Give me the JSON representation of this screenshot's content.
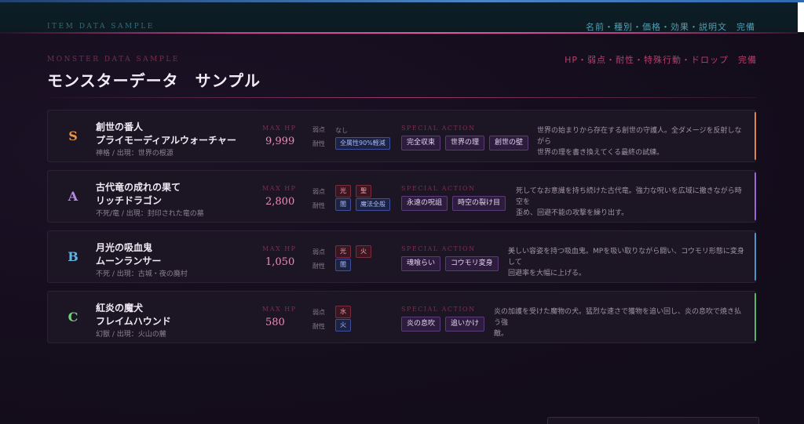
{
  "top_section": {
    "eyebrow": "ITEM DATA SAMPLE",
    "meta": "名前・種別・価格・効果・説明文　完備"
  },
  "monster_section": {
    "eyebrow": "MONSTER DATA SAMPLE",
    "meta": "HP・弱点・耐性・特殊行動・ドロップ　完備",
    "title": "モンスターデータ　サンプル"
  },
  "labels": {
    "max_hp": "MAX HP",
    "weakness": "弱点",
    "resistance": "耐性",
    "special_action": "SPECIAL ACTION"
  },
  "colors": {
    "rank_S": "#e8944a",
    "rank_A": "#b58be8",
    "rank_B": "#5fb4e6",
    "rank_C": "#6ed37a",
    "accent_S": "#e0864a",
    "accent_A": "#9d66d8",
    "accent_B": "#4a96c8",
    "accent_C": "#56b866"
  },
  "monsters": [
    {
      "rank": "S",
      "name_jp": "創世の番人",
      "name_kana": "プライモーディアルウォーチャー",
      "origin": "神格 / 出現：世界の根源",
      "hp": "9,999",
      "weakness": [],
      "weakness_none": "なし",
      "resistance": [
        "全属性90%軽減"
      ],
      "special_actions": [
        "完全収束",
        "世界の理",
        "創世の壁"
      ],
      "description": [
        "世界の始まりから存在する創世の守護人。全ダメージを反射しながら",
        "世界の理を書き換えてくる最終の試練。"
      ]
    },
    {
      "rank": "A",
      "name_jp": "古代竜の成れの果て",
      "name_kana": "リッチドラゴン",
      "origin": "不死/竜 / 出現：封印された竜の墓",
      "hp": "2,800",
      "weakness": [
        "光",
        "聖"
      ],
      "resistance": [
        "闇",
        "魔法全般"
      ],
      "special_actions": [
        "永遠の呪詛",
        "時空の裂け目"
      ],
      "description": [
        "死してなお意識を持ち続けた古代竜。強力な呪いを広域に撒きながら時空を",
        "歪め、回避不能の攻撃を繰り出す。"
      ]
    },
    {
      "rank": "B",
      "name_jp": "月光の吸血鬼",
      "name_kana": "ムーンランサー",
      "origin": "不死 / 出現：古城・夜の廃村",
      "hp": "1,050",
      "weakness": [
        "光",
        "火"
      ],
      "resistance": [
        "闇"
      ],
      "special_actions": [
        "魂喰らい",
        "コウモリ変身"
      ],
      "description": [
        "美しい容姿を持つ吸血鬼。MPを吸い取りながら闘い、コウモリ形態に変身して",
        "回避率を大幅に上げる。"
      ]
    },
    {
      "rank": "C",
      "name_jp": "紅炎の魔犬",
      "name_kana": "フレイムハウンド",
      "origin": "幻獣 / 出現：火山の麓",
      "hp": "580",
      "weakness": [
        "水"
      ],
      "resistance": [
        "火"
      ],
      "special_actions": [
        "炎の息吹",
        "追いかけ"
      ],
      "description": [
        "炎の加護を受けた魔物の犬。猛烈な速さで獲物を追い回し、炎の息吹で焼き払う強",
        "敵。"
      ]
    }
  ]
}
